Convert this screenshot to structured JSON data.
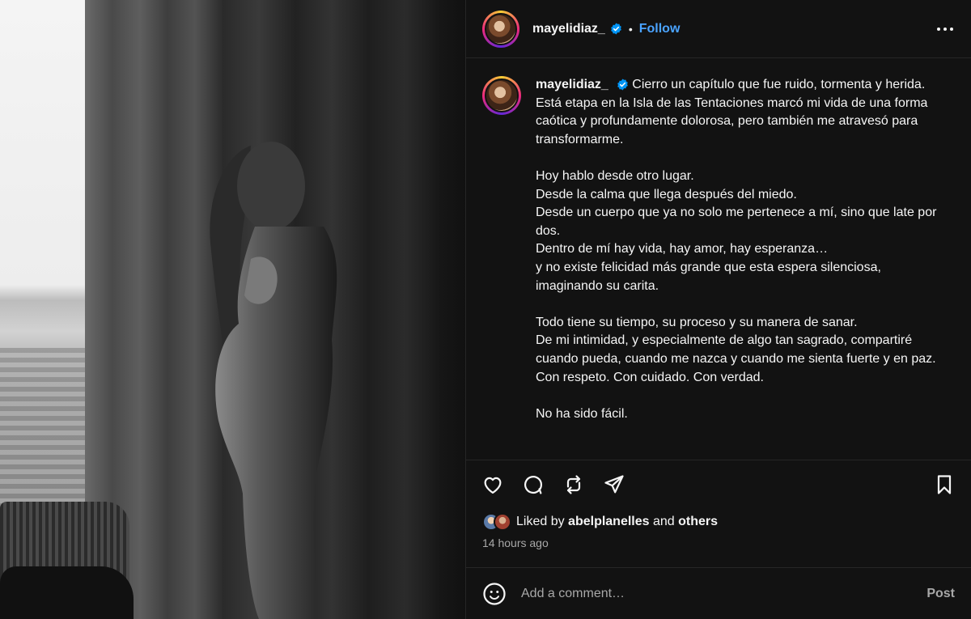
{
  "author": {
    "username": "mayelidiaz_",
    "verified": true,
    "follow_label": "Follow",
    "separator": "•"
  },
  "caption": {
    "username": "mayelidiaz_",
    "paragraphs": [
      [
        "Cierro un capítulo que fue ruido, tormenta y herida.",
        "Está etapa en la Isla de las Tentaciones marcó mi vida de una forma caótica y profundamente dolorosa, pero también me atravesó para transformarme."
      ],
      [
        "Hoy hablo desde otro lugar.",
        "Desde la calma que llega después del miedo.",
        "Desde un cuerpo que ya no solo me pertenece a mí, sino que late por dos.",
        "Dentro de mí hay vida, hay amor, hay esperanza…",
        "y no existe felicidad más grande que esta espera silenciosa, imaginando su carita."
      ],
      [
        "Todo tiene su tiempo, su proceso y su manera de sanar.",
        "De mi intimidad, y especialmente de algo tan sagrado, compartiré cuando pueda, cuando me nazca y cuando me sienta fuerte y en paz.",
        "Con respeto. Con cuidado. Con verdad."
      ],
      [
        "No ha sido fácil."
      ]
    ]
  },
  "actions": {
    "icons": [
      "heart-icon",
      "comment-icon",
      "repost-icon",
      "share-icon",
      "bookmark-icon"
    ]
  },
  "likes": {
    "prefix": "Liked by",
    "user": "abelplanelles",
    "conjunction": "and",
    "others": "others"
  },
  "timestamp": "14 hours ago",
  "comment": {
    "placeholder": "Add a comment…",
    "post_label": "Post"
  },
  "colors": {
    "background": "#121212",
    "accent": "#4aa3ff",
    "muted": "#a8a8a8",
    "verified": "#0095f6"
  }
}
